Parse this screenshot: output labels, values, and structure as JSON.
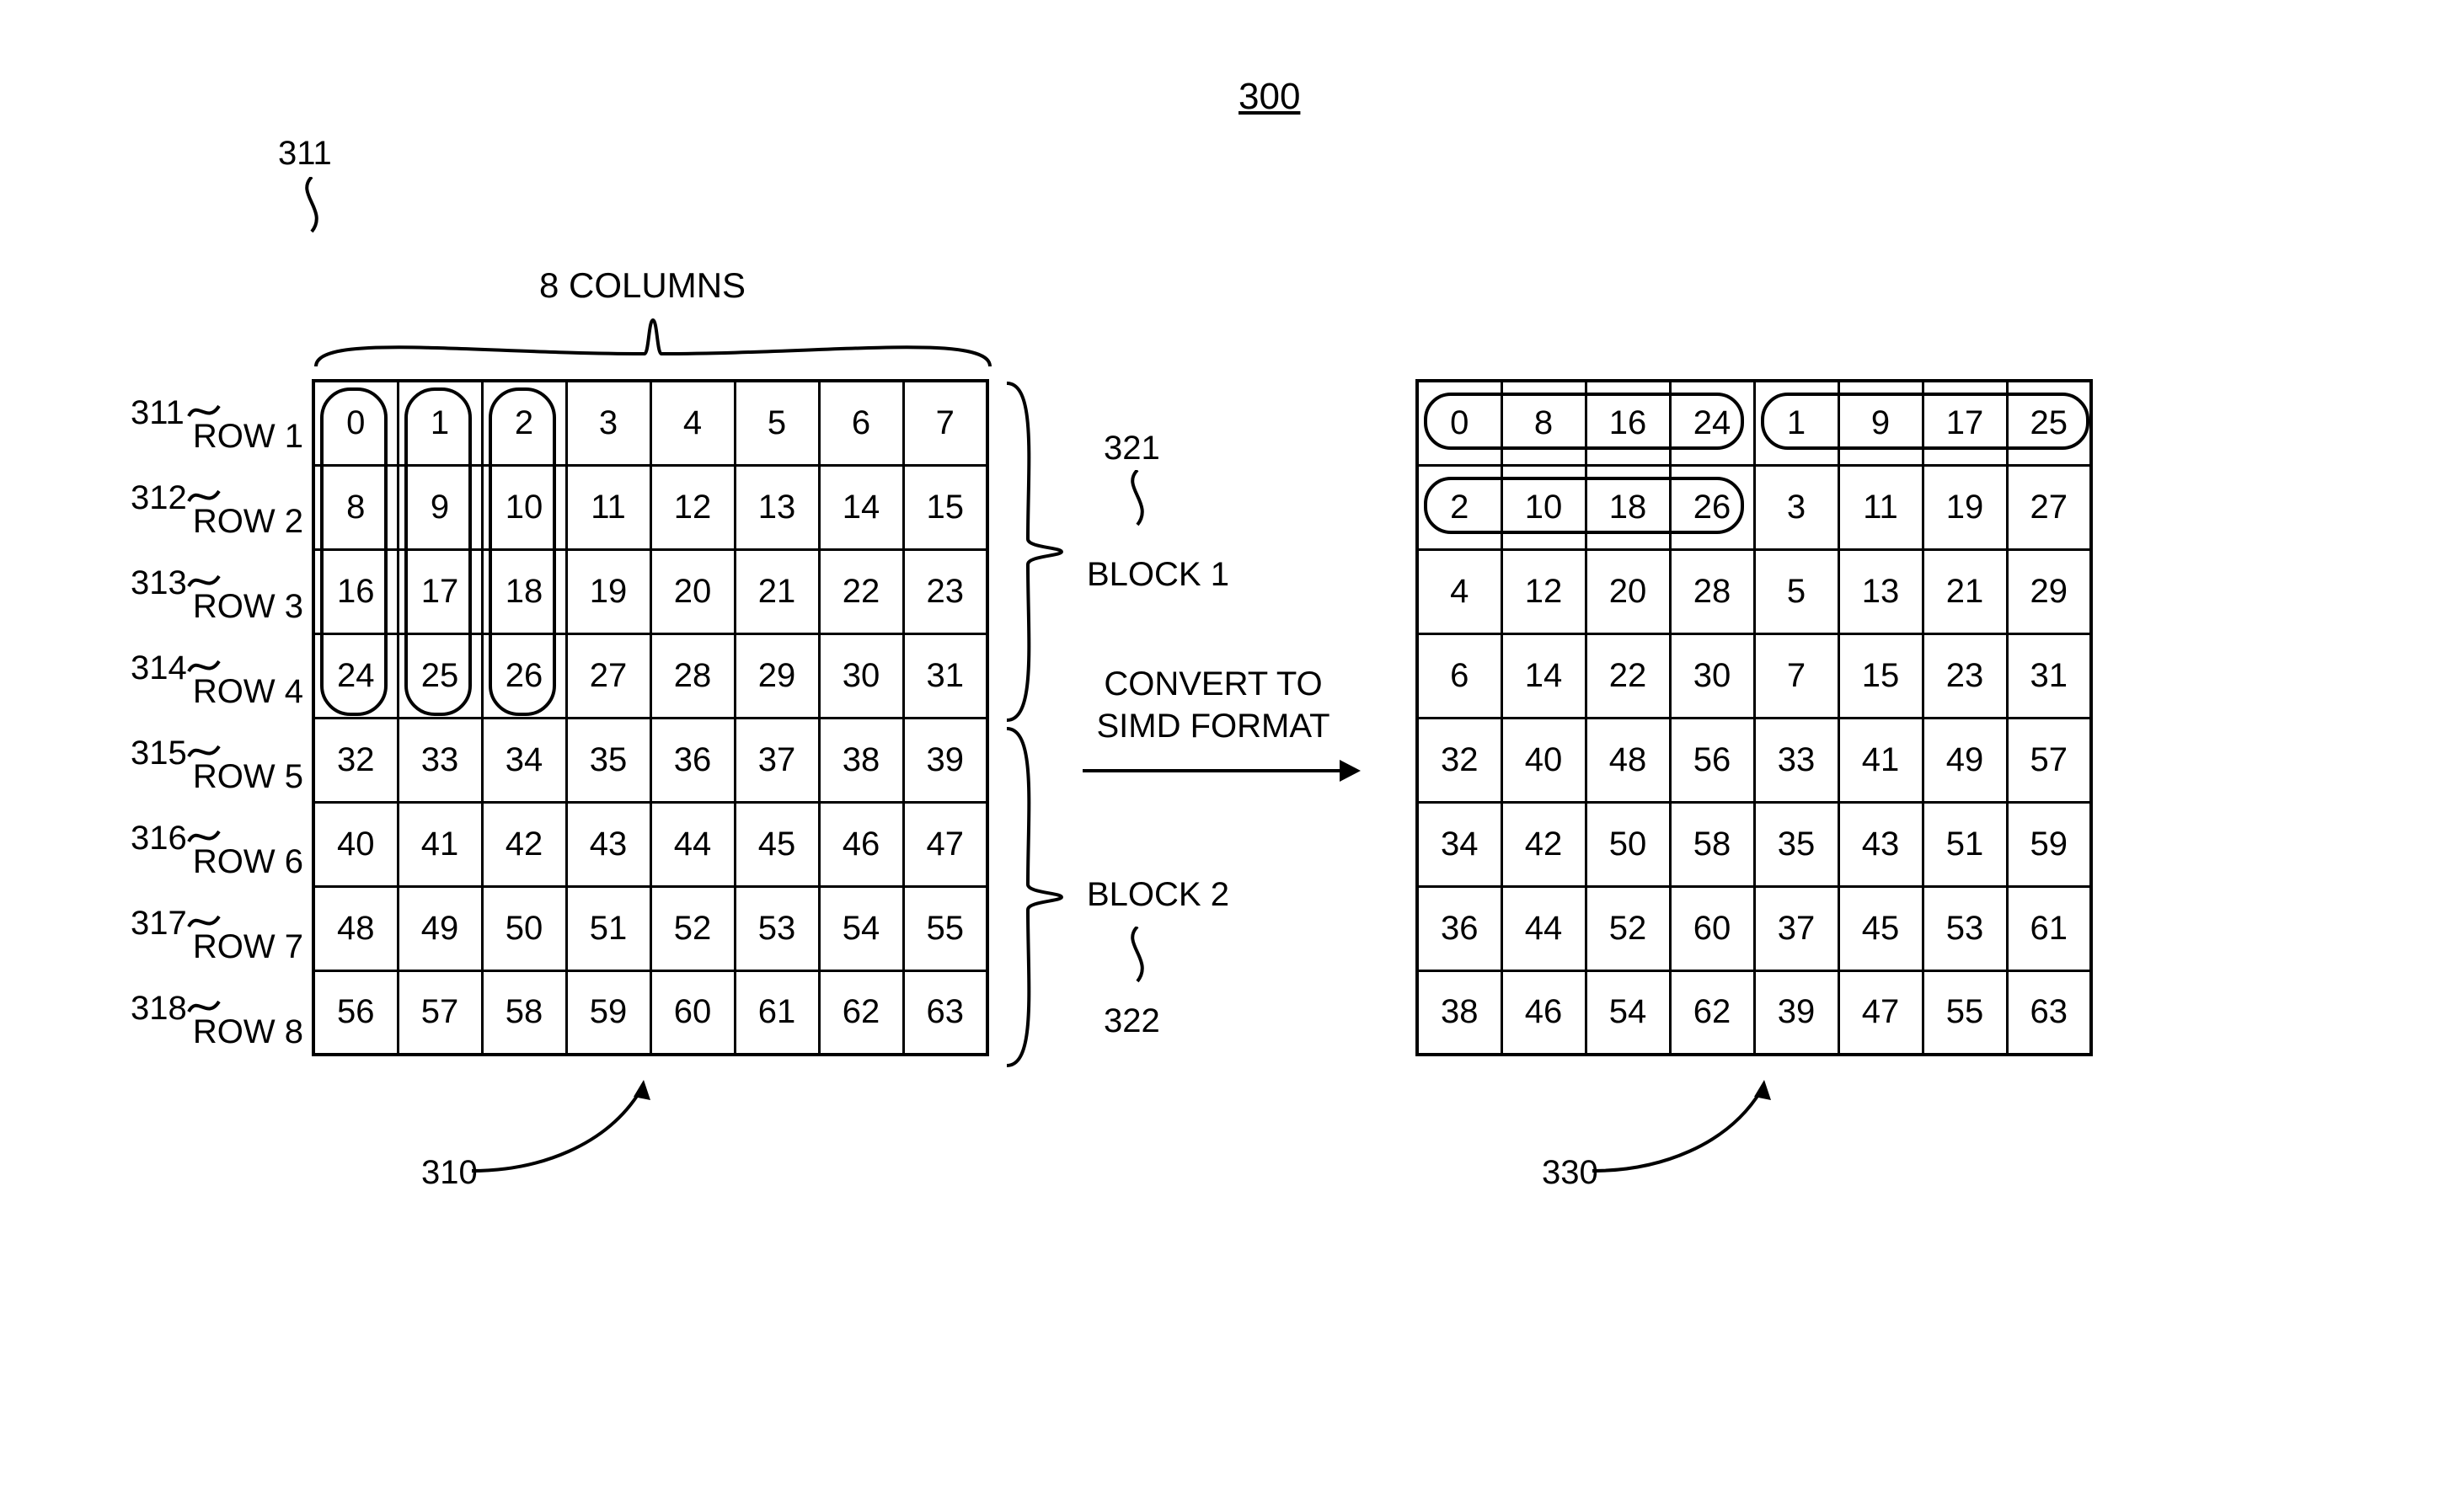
{
  "figureId": "300",
  "topLeftRef": "311",
  "columnsLabel": "8 COLUMNS",
  "rowRefs": [
    "311",
    "312",
    "313",
    "314",
    "315",
    "316",
    "317",
    "318"
  ],
  "rowLabels": [
    "ROW 1",
    "ROW 2",
    "ROW 3",
    "ROW 4",
    "ROW 5",
    "ROW 6",
    "ROW 7",
    "ROW 8"
  ],
  "gridLeft": [
    [
      0,
      1,
      2,
      3,
      4,
      5,
      6,
      7
    ],
    [
      8,
      9,
      10,
      11,
      12,
      13,
      14,
      15
    ],
    [
      16,
      17,
      18,
      19,
      20,
      21,
      22,
      23
    ],
    [
      24,
      25,
      26,
      27,
      28,
      29,
      30,
      31
    ],
    [
      32,
      33,
      34,
      35,
      36,
      37,
      38,
      39
    ],
    [
      40,
      41,
      42,
      43,
      44,
      45,
      46,
      47
    ],
    [
      48,
      49,
      50,
      51,
      52,
      53,
      54,
      55
    ],
    [
      56,
      57,
      58,
      59,
      60,
      61,
      62,
      63
    ]
  ],
  "gridRight": [
    [
      0,
      8,
      16,
      24,
      1,
      9,
      17,
      25
    ],
    [
      2,
      10,
      18,
      26,
      3,
      11,
      19,
      27
    ],
    [
      4,
      12,
      20,
      28,
      5,
      13,
      21,
      29
    ],
    [
      6,
      14,
      22,
      30,
      7,
      15,
      23,
      31
    ],
    [
      32,
      40,
      48,
      56,
      33,
      41,
      49,
      57
    ],
    [
      34,
      42,
      50,
      58,
      35,
      43,
      51,
      59
    ],
    [
      36,
      44,
      52,
      60,
      37,
      45,
      53,
      61
    ],
    [
      38,
      46,
      54,
      62,
      39,
      47,
      55,
      63
    ]
  ],
  "block1": {
    "ref": "321",
    "label": "BLOCK 1"
  },
  "block2": {
    "ref": "322",
    "label": "BLOCK 2"
  },
  "convertLine1": "CONVERT TO",
  "convertLine2": "SIMD FORMAT",
  "leftGridRef": "310",
  "rightGridRef": "330"
}
